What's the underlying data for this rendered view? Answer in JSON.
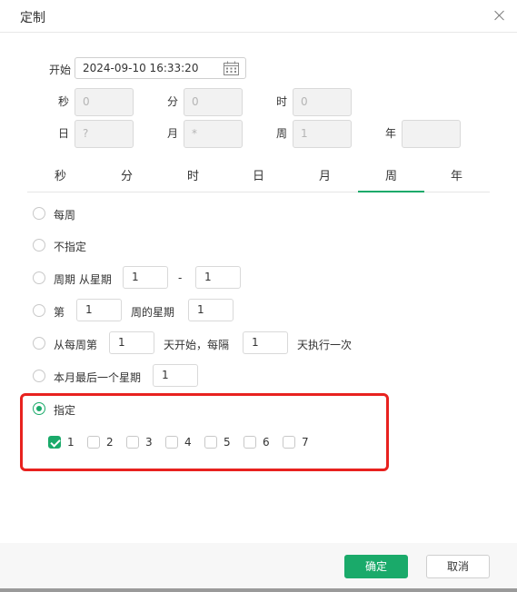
{
  "dialog": {
    "title": "定制"
  },
  "start": {
    "label": "开始",
    "value": "2024-09-10 16:33:20"
  },
  "fields": [
    {
      "label": "秒",
      "value": "0"
    },
    {
      "label": "分",
      "value": "0"
    },
    {
      "label": "时",
      "value": "0"
    },
    {
      "label": "日",
      "value": "?"
    },
    {
      "label": "月",
      "value": "*"
    },
    {
      "label": "周",
      "value": "1"
    },
    {
      "label": "年",
      "value": ""
    }
  ],
  "tabs": [
    "秒",
    "分",
    "时",
    "日",
    "月",
    "周",
    "年"
  ],
  "active_tab": "周",
  "options": {
    "every_week": "每周",
    "unspecified": "不指定",
    "period": {
      "label": "周期 从星期",
      "from": "1",
      "dash": "-",
      "to": "1"
    },
    "nth": {
      "label": "第",
      "n": "1",
      "mid": "周的星期",
      "day": "1"
    },
    "start_interval": {
      "label": "从每周第",
      "start": "1",
      "mid": "天开始，每隔",
      "interval": "1",
      "suffix": "天执行一次"
    },
    "last_of_month": {
      "label": "本月最后一个星期",
      "value": "1"
    },
    "specify": {
      "label": "指定",
      "days": [
        {
          "label": "1",
          "checked": true
        },
        {
          "label": "2",
          "checked": false
        },
        {
          "label": "3",
          "checked": false
        },
        {
          "label": "4",
          "checked": false
        },
        {
          "label": "5",
          "checked": false
        },
        {
          "label": "6",
          "checked": false
        },
        {
          "label": "7",
          "checked": false
        }
      ]
    }
  },
  "selected_option": "specify",
  "footer": {
    "confirm": "确定",
    "cancel": "取消"
  },
  "colors": {
    "accent": "#1aaa6a",
    "highlight": "#e8221f"
  },
  "icons": {
    "close": "close-icon",
    "calendar": "calendar-icon"
  }
}
